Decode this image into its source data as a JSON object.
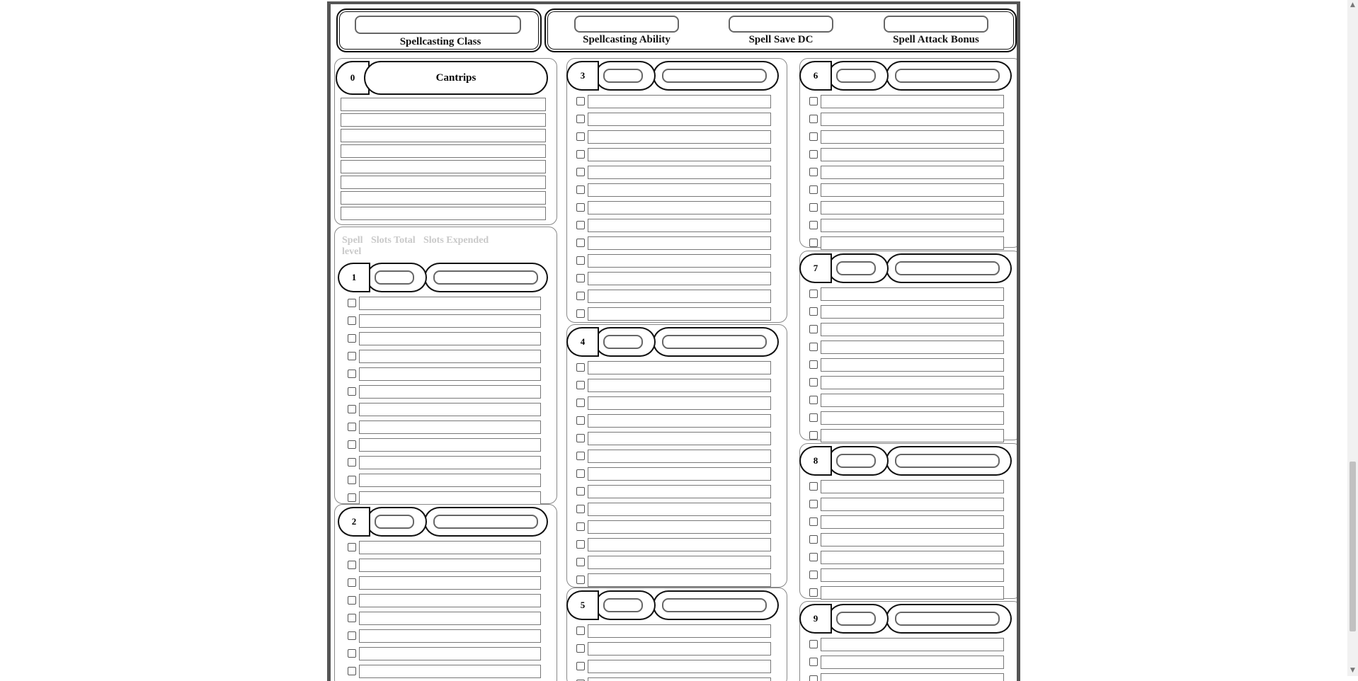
{
  "header": {
    "spellcasting_class_label": "Spellcasting Class",
    "spellcasting_ability_label": "Spellcasting Ability",
    "spell_save_dc_label": "Spell Save DC",
    "spell_attack_bonus_label": "Spell Attack Bonus"
  },
  "cantrips": {
    "level": "0",
    "title": "Cantrips"
  },
  "legend": {
    "spell_level": "Spell level",
    "slots_total": "Slots Total",
    "slots_expended": "Slots Expended"
  },
  "levels": [
    {
      "level": "1"
    },
    {
      "level": "2"
    },
    {
      "level": "3"
    },
    {
      "level": "4"
    },
    {
      "level": "5"
    },
    {
      "level": "6"
    },
    {
      "level": "7"
    },
    {
      "level": "8"
    },
    {
      "level": "9"
    }
  ],
  "icons": {
    "checkbox": "prepared-checkbox-icon",
    "scroll_up": "chevron-up-icon",
    "scroll_down": "chevron-down-icon"
  }
}
